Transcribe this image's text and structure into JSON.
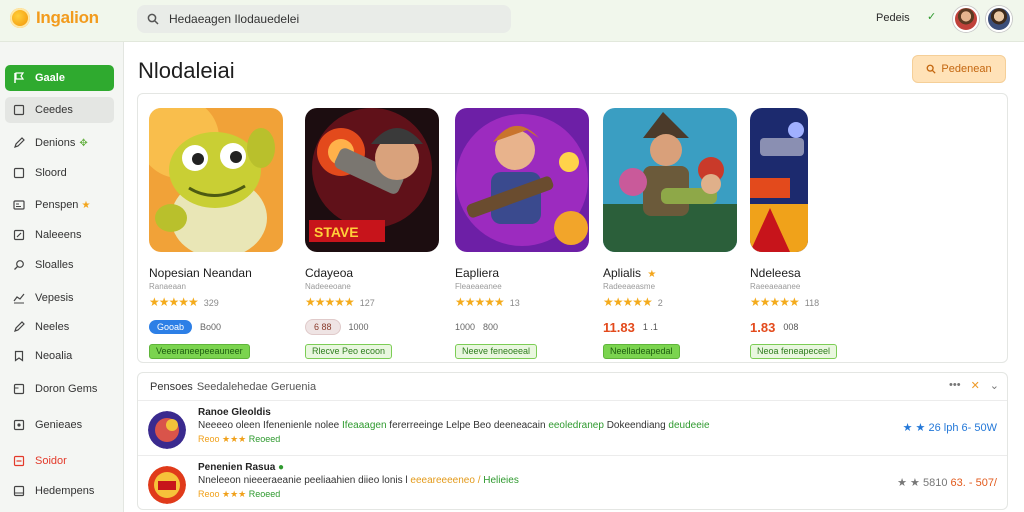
{
  "app": {
    "name": "Ingalion"
  },
  "search": {
    "value": "Hedaeagen Ilodauedelei"
  },
  "user": {
    "name": "Pedeis"
  },
  "sidebar": {
    "items": [
      {
        "label": "Gaale",
        "icon": "flag-icon"
      },
      {
        "label": "Ceedes",
        "icon": "square-icon"
      },
      {
        "label": "Denions",
        "icon": "edit-icon"
      },
      {
        "label": "Sloord",
        "icon": "square-icon"
      },
      {
        "label": "Penspen",
        "icon": "gamepad-icon"
      },
      {
        "label": "Naleeens",
        "icon": "edit-box-icon"
      },
      {
        "label": "Sloalles",
        "icon": "search-icon"
      },
      {
        "label": "Vepesis",
        "icon": "chart-icon"
      },
      {
        "label": "Neeles",
        "icon": "edit-icon"
      },
      {
        "label": "Neoalia",
        "icon": "bookmark-icon"
      },
      {
        "label": "Doron Gems",
        "icon": "gem-icon"
      },
      {
        "label": "Genieaes",
        "icon": "box-icon"
      },
      {
        "label": "Soidor",
        "icon": "warning-icon"
      },
      {
        "label": "Hedempens",
        "icon": "inbox-icon"
      }
    ]
  },
  "main": {
    "title": "Nlodaleiai",
    "action_label": "Pedenean"
  },
  "cards": [
    {
      "title": "Nopesian Neandan",
      "subtitle": "Ranaeaan",
      "stars": "★★★★★",
      "count": "329",
      "price": {
        "pill": "Gooab",
        "text": "Bo00"
      },
      "tag": "Veeeraneepeeauneer"
    },
    {
      "title": "Cdayeoa",
      "subtitle": "Nadeeeoane",
      "stars": "★★★★★",
      "count": "127",
      "price": {
        "pill": "6 88",
        "text": "1000"
      },
      "tag": "Rlecve Peo ecoon"
    },
    {
      "title": "Eapliera",
      "subtitle": "Fleaeaeanee",
      "stars": "★★★★★",
      "count": "13",
      "price": {
        "muted": "1000",
        "text": "800"
      },
      "tag": "Neeve feneoeeal"
    },
    {
      "title": "Aplialis",
      "subtitle": "Radeeaeasme",
      "stars": "★★★★★",
      "count": "2",
      "price": {
        "big": "11.83",
        "text": "1 .1"
      },
      "tag": "Neelladeapedal"
    },
    {
      "title": "Ndeleesa",
      "subtitle": "Raeeaeaanee",
      "stars": "★★★★★",
      "count": "118",
      "price": {
        "big": "1.83",
        "text": "008"
      },
      "tag": "Neoa feneapeceel"
    }
  ],
  "list": {
    "title": "Pensoes",
    "subtitle": "Seedalehedae Geruenia",
    "rows": [
      {
        "title": "Ranoe Gleoldis",
        "desc_a": "Neeeeo oleen Ifenenienle nolee",
        "desc_b": "Ifeaaagen",
        "desc_c": "fererreeinge",
        "desc_d": "Lelpe Beo deeneacain",
        "desc_e": "eeoledranep",
        "desc_f": "Dokeendiang",
        "desc_g": "deudeeie",
        "meta_a": "Reoo",
        "meta_stars": "★★★",
        "meta_b": "Reoeed",
        "right_stars": "★ ★",
        "right_text": "26 lph",
        "right_amt": "6- 50W",
        "right_color": "blue"
      },
      {
        "title": "Penenien Rasua",
        "desc_a": "Nneleeon nieeeraeanie peeliaahien diieo",
        "desc_b": "lonis l",
        "desc_c": "eeeareeeeneo /",
        "desc_d": "Helieies",
        "desc_e": "",
        "desc_f": "",
        "desc_g": "",
        "meta_a": "Reoo",
        "meta_stars": "★★★",
        "meta_b": "Reoeed",
        "right_stars": "★ ★",
        "right_text": "5810",
        "right_amt": "63. - 507/",
        "right_color": "grey"
      }
    ]
  },
  "colors": {
    "accent": "#2faa2f",
    "brand": "#f29b1d",
    "star": "#f4ab1c",
    "price": "#e34a1c"
  }
}
